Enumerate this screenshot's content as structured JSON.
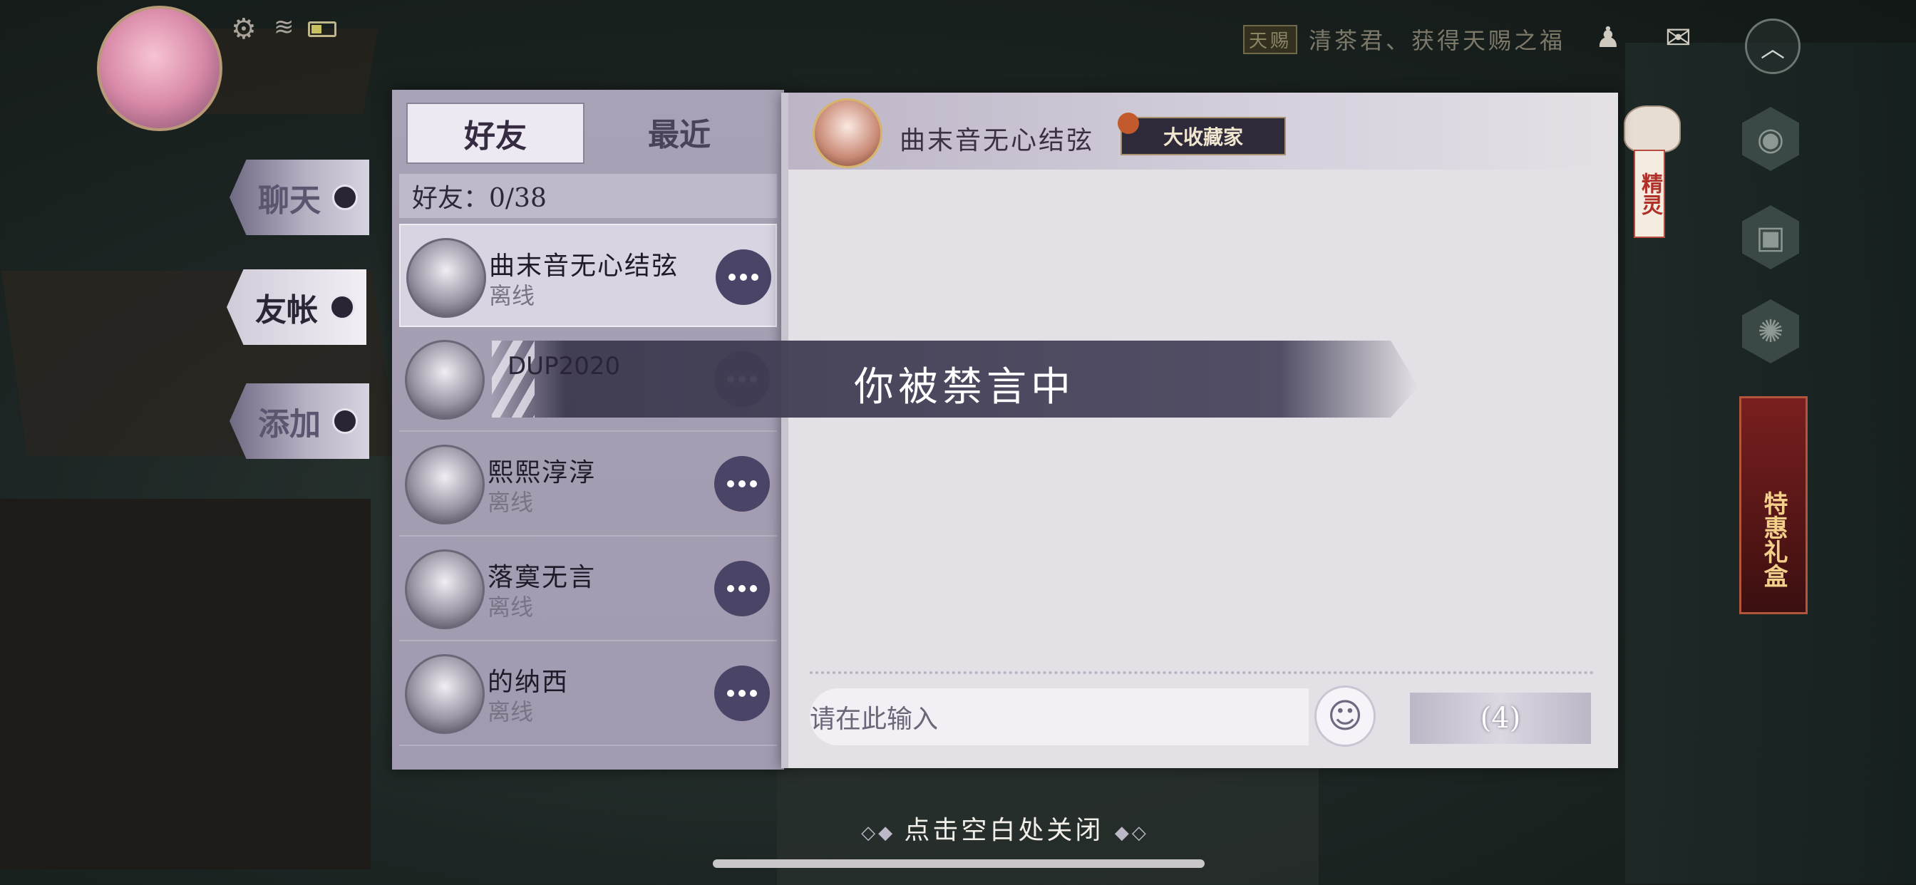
{
  "hud": {
    "notice_badge": "天赐",
    "notice_text": "清茶君、获得天赐之福",
    "up_arrow_icon": "chevron-up-icon"
  },
  "side_tabs": [
    {
      "label": "聊天",
      "active": false
    },
    {
      "label": "友帐",
      "active": true
    },
    {
      "label": "添加",
      "active": false
    }
  ],
  "friend_panel": {
    "tab_friends": "好友",
    "tab_recent": "最近",
    "friend_count": "好友：0/38",
    "friends": [
      {
        "name": "曲末音无心结弦",
        "status": "离线",
        "selected": true
      },
      {
        "name": "DUP2020",
        "status": "",
        "selected": false
      },
      {
        "name": "熙熙淳淳",
        "status": "离线",
        "selected": false
      },
      {
        "name": "落寞无言",
        "status": "离线",
        "selected": false
      },
      {
        "name": "的纳西",
        "status": "离线",
        "selected": false
      }
    ]
  },
  "chat": {
    "contact_name": "曲末音无心结弦",
    "collector_badge": "大收藏家",
    "input_placeholder": "请在此输入",
    "send_label": "(4)"
  },
  "muted_banner": "你被禁言中",
  "right_rail": {
    "spirit_label": "精灵",
    "gift_label": "特惠礼盒"
  },
  "close_hint": "点击空白处关闭"
}
